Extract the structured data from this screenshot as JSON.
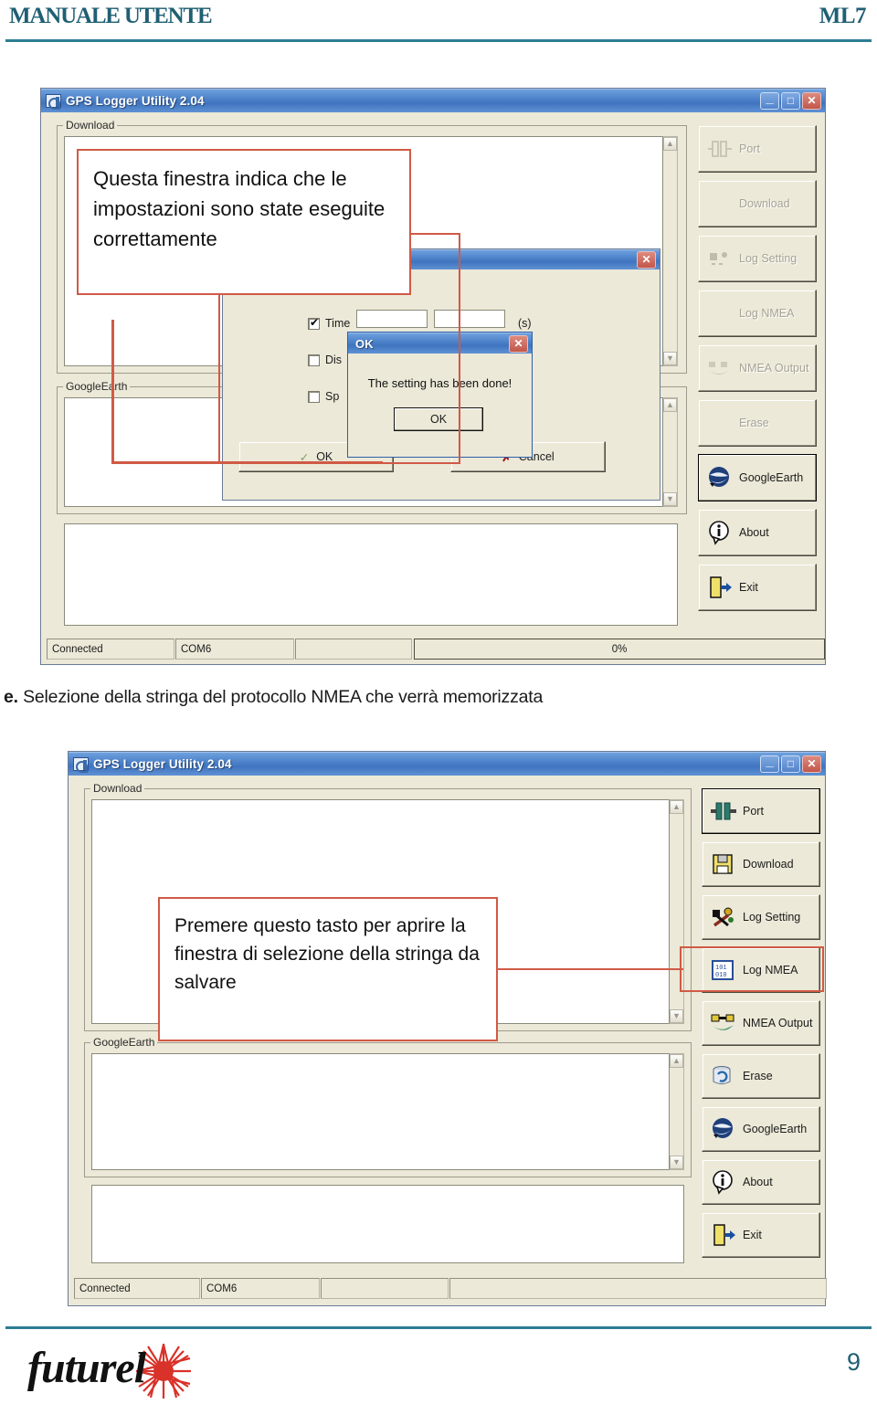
{
  "page": {
    "header_left": "MANUALE UTENTE",
    "header_right": "ML7",
    "footer_logo": "futurel",
    "page_number": "9",
    "accent_color": "#1F5F73",
    "annotation_color": "#d05a46"
  },
  "caption": {
    "prefix": "e.",
    "text": "Selezione della stringa del protocollo NMEA che verrà memorizzata"
  },
  "screenshot1": {
    "window": {
      "title": "GPS Logger Utility 2.04",
      "titlebar_buttons": [
        "minimize",
        "maximize",
        "close"
      ]
    },
    "groups": {
      "download_label": "Download",
      "googleearth_label": "GoogleEarth"
    },
    "buttons": [
      {
        "label": "Port",
        "icon": "port-icon",
        "state": "disabled"
      },
      {
        "label": "Download",
        "icon": "download-icon",
        "state": "disabled"
      },
      {
        "label": "Log Setting",
        "icon": "log-setting-icon",
        "state": "disabled"
      },
      {
        "label": "Log NMEA",
        "icon": "log-nmea-icon",
        "state": "disabled"
      },
      {
        "label": "NMEA Output",
        "icon": "nmea-output-icon",
        "state": "disabled"
      },
      {
        "label": "Erase",
        "icon": "erase-icon",
        "state": "disabled"
      },
      {
        "label": "GoogleEarth",
        "icon": "googleearth-icon",
        "state": "focused"
      },
      {
        "label": "About",
        "icon": "about-icon",
        "state": "enabled"
      },
      {
        "label": "Exit",
        "icon": "exit-icon",
        "state": "enabled"
      }
    ],
    "statusbar": {
      "connection": "Connected",
      "port": "COM6",
      "extra": "",
      "progress": "0%"
    },
    "log_setting_dialog": {
      "checkboxes": [
        {
          "label": "Time",
          "checked": true,
          "suffix": "(s)"
        },
        {
          "label": "Dis",
          "checked": false,
          "suffix": ""
        },
        {
          "label": "Sp",
          "checked": false,
          "suffix": ""
        }
      ],
      "ok_label": "OK",
      "cancel_label": "Cancel"
    },
    "ok_dialog": {
      "title": "OK",
      "message": "The setting has been done!",
      "button_label": "OK"
    },
    "annotation": "Questa finestra indica che le impostazioni sono state eseguite correttamente"
  },
  "screenshot2": {
    "window": {
      "title": "GPS Logger Utility 2.04",
      "titlebar_buttons": [
        "minimize",
        "maximize",
        "close"
      ]
    },
    "groups": {
      "download_label": "Download",
      "googleearth_label": "GoogleEarth"
    },
    "buttons": [
      {
        "label": "Port",
        "icon": "port-icon",
        "state": "focused"
      },
      {
        "label": "Download",
        "icon": "download-icon",
        "state": "enabled"
      },
      {
        "label": "Log Setting",
        "icon": "log-setting-icon",
        "state": "enabled"
      },
      {
        "label": "Log NMEA",
        "icon": "log-nmea-icon",
        "state": "highlighted"
      },
      {
        "label": "NMEA Output",
        "icon": "nmea-output-icon",
        "state": "enabled"
      },
      {
        "label": "Erase",
        "icon": "erase-icon",
        "state": "enabled"
      },
      {
        "label": "GoogleEarth",
        "icon": "googleearth-icon",
        "state": "enabled"
      },
      {
        "label": "About",
        "icon": "about-icon",
        "state": "enabled"
      },
      {
        "label": "Exit",
        "icon": "exit-icon",
        "state": "enabled"
      }
    ],
    "statusbar": {
      "connection": "Connected",
      "port": "COM6",
      "extra": "",
      "progress": ""
    },
    "annotation": "Premere questo tasto per aprire la finestra di selezione della stringa da salvare"
  }
}
